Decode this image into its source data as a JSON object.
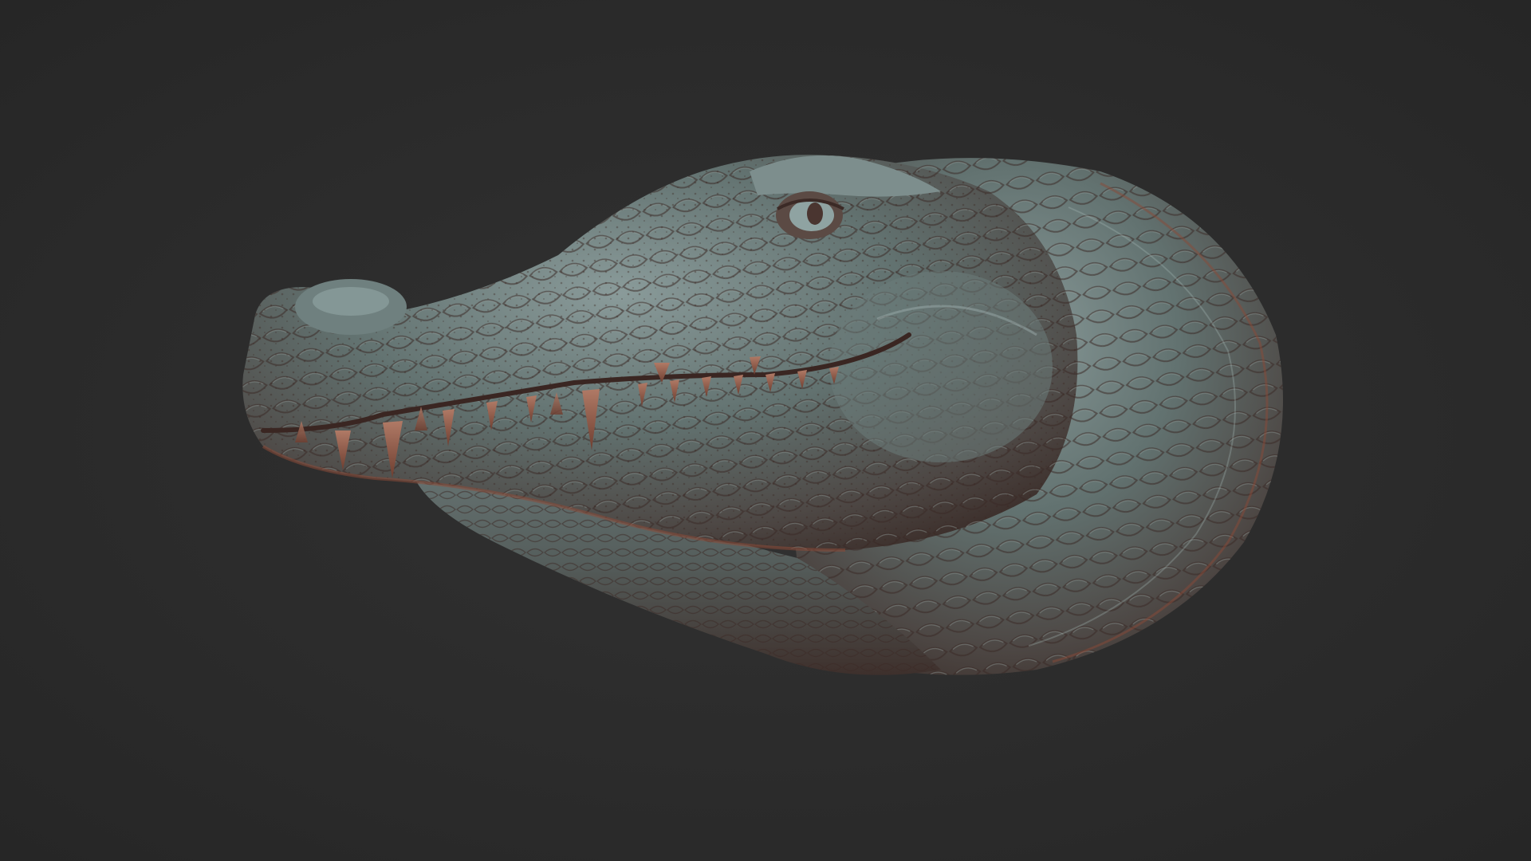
{
  "scene": {
    "subject": "crocodile-head-sculpt",
    "colors": {
      "background": "#2c2c2c",
      "skin_base": "#5d6b6a",
      "skin_shadow": "#4a3530",
      "skin_highlight": "#8fa3a3",
      "rim_copper": "#8a4a38",
      "teeth": "#9a6a58"
    }
  }
}
